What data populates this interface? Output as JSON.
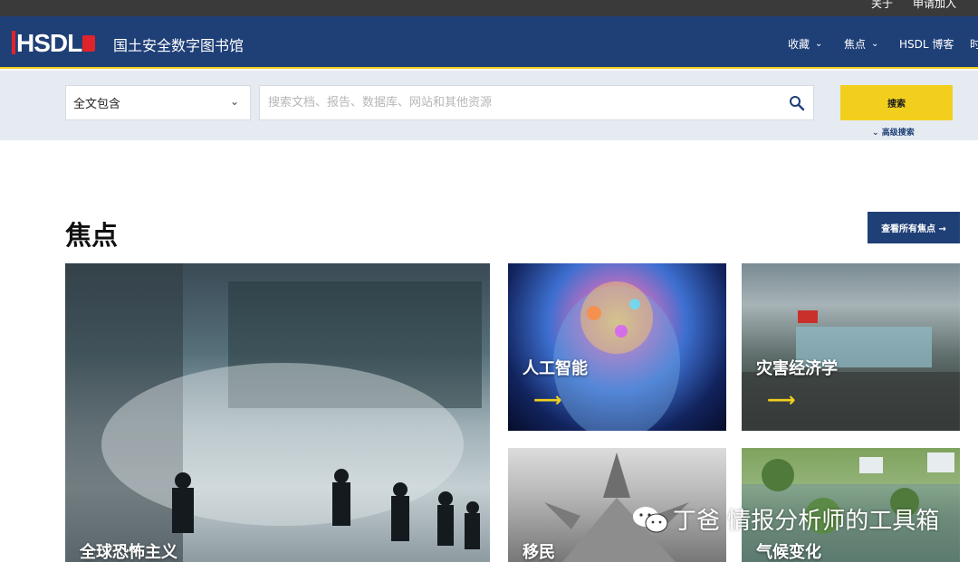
{
  "topbar": {
    "links": [
      "关于",
      "申请加入"
    ]
  },
  "header": {
    "logo_text": "HSDL",
    "site_title": "国土安全数字图书馆",
    "nav": [
      {
        "label": "收藏",
        "has_dropdown": true
      },
      {
        "label": "焦点",
        "has_dropdown": true
      },
      {
        "label": "HSDL 博客",
        "has_dropdown": false
      },
      {
        "label": "时",
        "has_dropdown": false
      }
    ]
  },
  "search": {
    "scope_value": "全文包含",
    "placeholder": "搜索文档、报告、数据库、网站和其他资源",
    "button_label": "搜索",
    "advanced_label": "高级搜索"
  },
  "focus": {
    "title": "焦点",
    "view_all_label": "查看所有焦点 →",
    "cards": [
      {
        "label": "全球恐怖主义"
      },
      {
        "label": "人工智能",
        "arrow": "⟶"
      },
      {
        "label": "灾害经济学",
        "arrow": "⟶"
      },
      {
        "label": "移民"
      },
      {
        "label": "气候变化"
      }
    ]
  },
  "watermark": {
    "text": "丁爸 情报分析师的工具箱"
  },
  "colors": {
    "brand_blue": "#1f3f77",
    "accent_yellow": "#f2cf1d",
    "search_band": "#e5ebf1"
  }
}
